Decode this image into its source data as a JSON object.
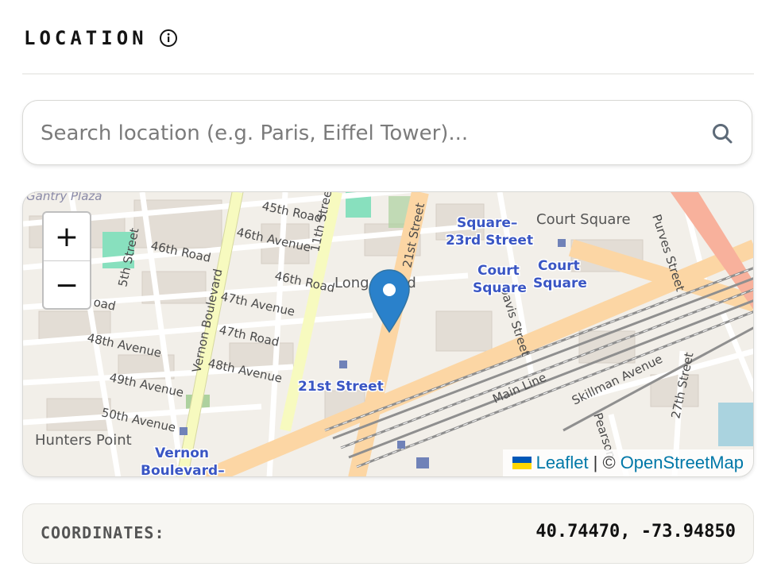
{
  "section": {
    "title": "LOCATION",
    "info_icon": "info-circle-icon"
  },
  "search": {
    "placeholder": "Search location (e.g. Paris, Eiffel Tower)...",
    "value": "",
    "icon": "search-icon"
  },
  "map": {
    "zoom_in_label": "+",
    "zoom_out_label": "−",
    "marker_icon": "map-pin-icon",
    "labels": {
      "gantry_plaza": "Gantry Plaza",
      "road_45": "45th Road",
      "ave_46": "46th Avenue",
      "road_46": "46th Road",
      "road_46b": "46th Road",
      "ave_47": "47th Avenue",
      "road_47": "47th Road",
      "ave_48": "48th Avenue",
      "ave_48b": "48th Avenue",
      "ave_49": "49th Avenue",
      "ave_50": "50th Avenue",
      "road_cut": "oad",
      "st_5": "5th Street",
      "st_11": "11th Street",
      "st_21": "21st Street",
      "vernon_blvd": "Vernon Boulevard",
      "long_island": "Long Island",
      "hunters_point": "Hunters Point",
      "court_square": "Court Square",
      "purves": "Purves Street",
      "davis": "Davis Street",
      "skillman": "Skillman Avenue",
      "pearson": "Pearson",
      "st_27": "27th Street",
      "main_line": "Main Line",
      "station_sq23_a": "Square–",
      "station_sq23_b": "23rd Street",
      "station_court_a": "Court",
      "station_court_b": "Square",
      "station_court2_a": "Court",
      "station_court2_b": "Square",
      "station_21st": "21st Street",
      "station_vernon_a": "Vernon",
      "station_vernon_b": "Boulevard–"
    },
    "attribution": {
      "leaflet": "Leaflet",
      "separator": "| ©",
      "osm": "OpenStreetMap"
    },
    "colors": {
      "background": "#f2efe9",
      "major_road": "#fcd6a4",
      "secondary_road": "#f7fabf",
      "motorway": "#f8b19c",
      "park": "#add19e",
      "pitch": "#88e0be",
      "station_label": "#3a56c4",
      "marker": "#2a81cb",
      "rail": "#787878"
    }
  },
  "coordinates": {
    "label": "COORDINATES:",
    "value": "40.74470, -73.94850"
  }
}
